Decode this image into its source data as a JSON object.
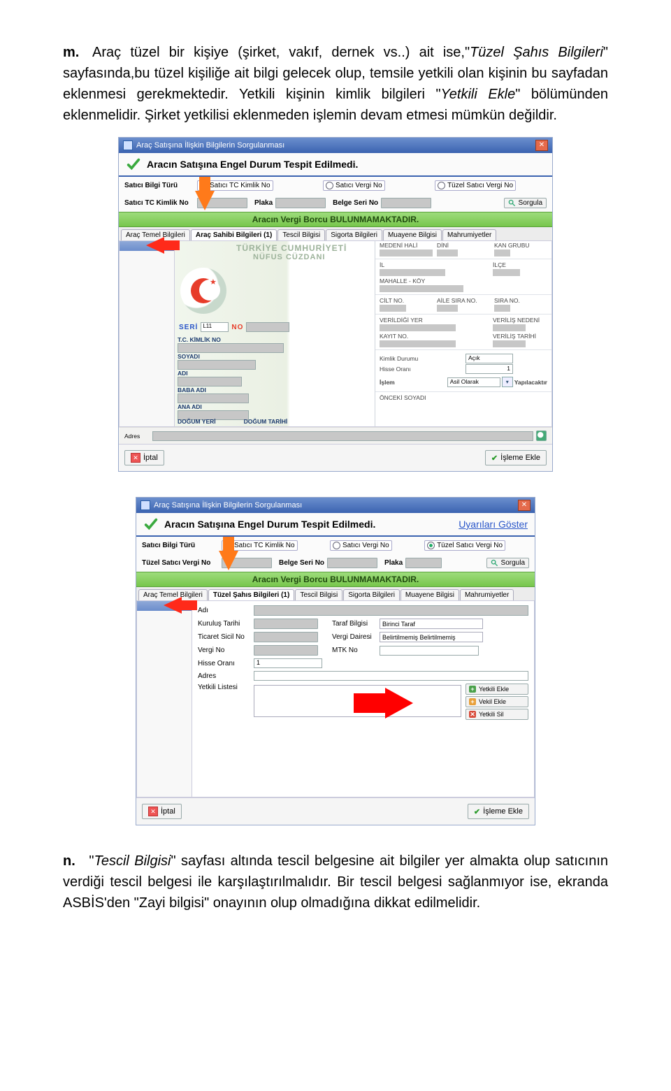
{
  "list_m_marker": "m.",
  "list_m_text_1": "Araç tüzel bir kişiye (şirket, vakıf, dernek vs..) ait ise,\"",
  "list_m_text_italic": "Tüzel Şahıs Bilgileri",
  "list_m_text_2": "\" sayfasında,bu tüzel kişiliğe ait bilgi gelecek olup, temsile yetkili olan kişinin bu sayfadan eklenmesi gerekmektedir. Yetkili kişinin kimlik bilgileri \"",
  "list_m_text_italic2": "Yetkili Ekle",
  "list_m_text_3": "\" bölümünden eklenmelidir. Şirket yetkilisi eklenmeden işlemin devam etmesi mümkün değildir.",
  "list_n_marker": "n.",
  "list_n_text_1": "\"",
  "list_n_text_italic": "Tescil Bilgisi",
  "list_n_text_2": "\" sayfası altında tescil belgesine ait bilgiler yer almakta olup satıcının verdiği tescil belgesi ile karşılaştırılmalıdır. Bir tescil belgesi sağlanmıyor ise, ekranda ASBİS'den \"Zayi bilgisi\" onayının olup olmadığına dikkat edilmelidir.",
  "win_title": "Araç Satışına İlişkin Bilgilerin Sorgulanması",
  "status_msg": "Aracın Satışına Engel Durum Tespit Edilmedi.",
  "uyari_link": "Uyarıları Göster",
  "lbl_satici_bilgi_turu": "Satıcı Bilgi Türü",
  "radio_tc": "Satıcı TC Kimlik No",
  "radio_vergi": "Satıcı Vergi No",
  "radio_tuzel": "Tüzel Satıcı Vergi No",
  "lbl_satici_tc": "Satıcı TC Kimlik No",
  "lbl_tuzel_vergi": "Tüzel Satıcı Vergi No",
  "lbl_plaka": "Plaka",
  "lbl_belge_seri": "Belge Seri No",
  "btn_sorgula": "Sorgula",
  "greenband": "Aracın Vergi Borcu BULUNMAMAKTADIR.",
  "tabs": {
    "t0": "Araç Temel Bilgileri",
    "t1": "Araç Sahibi Bilgileri (1)",
    "t1b": "Tüzel Şahıs Bilgileri (1)",
    "t2": "Tescil Bilgisi",
    "t3": "Sigorta Bilgileri",
    "t4": "Muayene Bilgisi",
    "t5": "Mahrumiyetler"
  },
  "nufus": {
    "h1": "TÜRKİYE CUMHURİYETİ",
    "h2": "NÜFUS  CÜZDANI",
    "seri": "SERİ",
    "seri_val": "L11",
    "no": "NO",
    "tc": "T.C. KİMLİK NO",
    "soyadi": "SOYADI",
    "adi": "ADI",
    "baba": "BABA ADI",
    "ana": "ANA ADI",
    "dogyer": "DOĞUM YERİ",
    "dogtar": "DOĞUM TARİHİ",
    "medeni": "MEDENİ HALİ",
    "dini": "DİNİ",
    "kan": "KAN GRUBU",
    "il": "İL",
    "ilce": "İLÇE",
    "mahkoy": "MAHALLE - KÖY",
    "cilt": "CİLT NO.",
    "aile": "AİLE SIRA NO.",
    "sira": "SIRA NO.",
    "veryer": "VERİLDİĞİ YER",
    "verned": "VERİLİŞ NEDENİ",
    "kayit": "KAYIT NO.",
    "vertar": "VERİLİŞ TARİHİ",
    "kimlikdurum": "Kimlik Durumu",
    "kimlikdurum_val": "Açık",
    "hisse": "Hisse Oranı",
    "hisse_val": "1",
    "islem": "İşlem",
    "islem_val": "Asil Olarak",
    "yapil": "Yapılacaktır",
    "onceki": "ÖNCEKİ SOYADI"
  },
  "adres": "Adres",
  "btn_iptal": "İptal",
  "btn_isleme": "İşleme Ekle",
  "detail": {
    "adi": "Adı",
    "kurulus": "Kuruluş Tarihi",
    "ticaret": "Ticaret Sicil No",
    "vergino": "Vergi No",
    "hisse": "Hisse Oranı",
    "hisse_val": "1",
    "taraf": "Taraf Bilgisi",
    "taraf_val": "Birinci Taraf",
    "vergidaire": "Vergi Dairesi",
    "vergidaire_val": "Belirtilmemiş  Belirtilmemiş",
    "mtk": "MTK No",
    "adres": "Adres",
    "yetkili": "Yetkili Listesi",
    "yekle": "Yetkili Ekle",
    "vekle": "Vekil Ekle",
    "ysil": "Yetkili Sil"
  }
}
